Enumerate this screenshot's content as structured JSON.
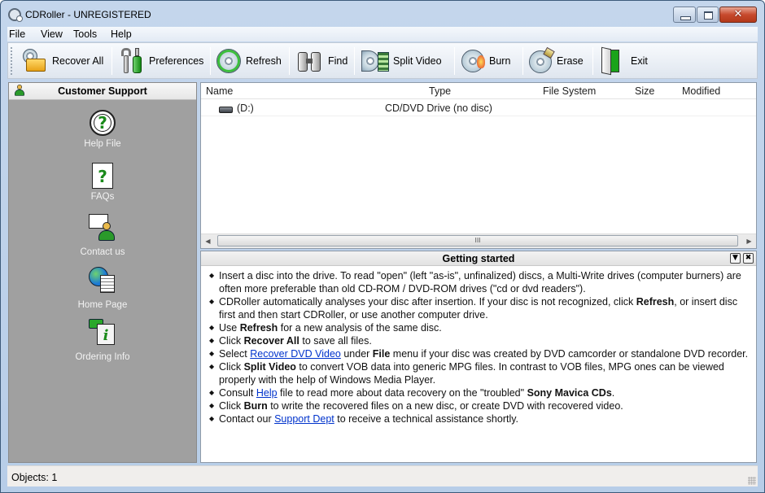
{
  "window": {
    "title": "CDRoller - UNREGISTERED",
    "controls": {
      "minimize": "minimize",
      "maximize": "maximize",
      "close": "✕"
    }
  },
  "menu": [
    "File",
    "View",
    "Tools",
    "Help"
  ],
  "toolbar": {
    "buttons": [
      {
        "label": "Recover All",
        "icon": "disc-folder-icon"
      },
      {
        "label": "Preferences",
        "icon": "wrench-screwdriver-icon"
      },
      {
        "label": "Refresh",
        "icon": "refresh-disc-icon"
      },
      {
        "label": "Find",
        "icon": "binoculars-icon"
      },
      {
        "label": "Split Video",
        "icon": "disc-film-icon"
      },
      {
        "label": "Burn",
        "icon": "burn-disc-icon"
      },
      {
        "label": "Erase",
        "icon": "erase-disc-icon"
      },
      {
        "label": "Exit",
        "icon": "door-exit-icon"
      }
    ]
  },
  "sidebar": {
    "title": "Customer Support",
    "items": [
      {
        "label": "Help File",
        "icon": "help-circle-icon"
      },
      {
        "label": "FAQs",
        "icon": "faq-document-icon"
      },
      {
        "label": "Contact us",
        "icon": "envelope-person-icon"
      },
      {
        "label": "Home Page",
        "icon": "globe-page-icon"
      },
      {
        "label": "Ordering Info",
        "icon": "order-info-icon"
      }
    ]
  },
  "filelist": {
    "columns": [
      "Name",
      "Type",
      "File System",
      "Size",
      "Modified"
    ],
    "rows": [
      {
        "name": "(D:)",
        "type": "CD/DVD Drive (no disc)",
        "filesystem": "",
        "size": "",
        "modified": ""
      }
    ],
    "scroll_thumb": "III"
  },
  "getting_started": {
    "title": "Getting started",
    "collapse_glyph": "▼",
    "close_glyph": "✖",
    "lines": {
      "l1a": "Insert a disc into the drive. To read \"open\" (left \"as-is\", unfinalized) discs, a Multi-Write drives (computer burners) are often more preferable than old CD-ROM / DVD-ROM drives (\"cd or dvd readers\").",
      "l2a": "CDRoller automatically analyses your disc after insertion. If your disc is not recognized, click ",
      "l2b": "Refresh",
      "l2c": ", or insert disc first and then start CDRoller, or use another computer drive.",
      "l3a": "Use ",
      "l3b": "Refresh",
      "l3c": " for a new analysis of the same disc.",
      "l4a": "Click ",
      "l4b": "Recover All",
      "l4c": " to save all files.",
      "l5a": "Select ",
      "l5link": "Recover DVD Video",
      "l5b": " under ",
      "l5c": "File",
      "l5d": " menu if your disc was created by DVD camcorder or standalone DVD recorder.",
      "l6a": "Click ",
      "l6b": "Split Video",
      "l6c": " to convert VOB data into generic MPG files. In contrast to VOB files, MPG ones can be viewed properly with the help of Windows Media Player.",
      "l7a": "Consult ",
      "l7link": "Help",
      "l7b": " file to read more about data recovery on the \"troubled\" ",
      "l7c": "Sony Mavica CDs",
      "l7d": ".",
      "l8a": "Click ",
      "l8b": "Burn",
      "l8c": " to write the recovered files on a new disc, or create DVD with recovered video.",
      "l9a": "Contact our ",
      "l9link": "Support Dept",
      "l9b": " to receive a technical assistance shortly."
    }
  },
  "status": {
    "text": "Objects: 1"
  }
}
